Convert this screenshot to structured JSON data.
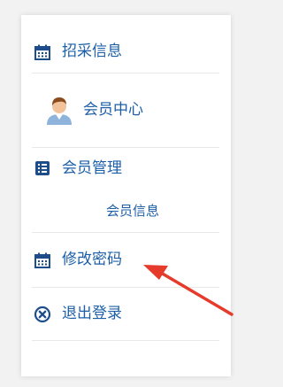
{
  "menu": {
    "procurement": {
      "label": "招采信息",
      "icon": "calendar-icon"
    },
    "member_center": {
      "label": "会员中心",
      "icon": "user-avatar-icon"
    },
    "member_manage": {
      "label": "会员管理",
      "icon": "list-icon"
    },
    "member_info": {
      "label": "会员信息"
    },
    "change_password": {
      "label": "修改密码",
      "icon": "calendar-icon"
    },
    "logout": {
      "label": "退出登录",
      "icon": "close-circle-icon"
    }
  },
  "colors": {
    "link": "#1c5fa8",
    "icon": "#1e4d8c",
    "arrow": "#e63a2b",
    "divider": "#e8e8e8"
  }
}
